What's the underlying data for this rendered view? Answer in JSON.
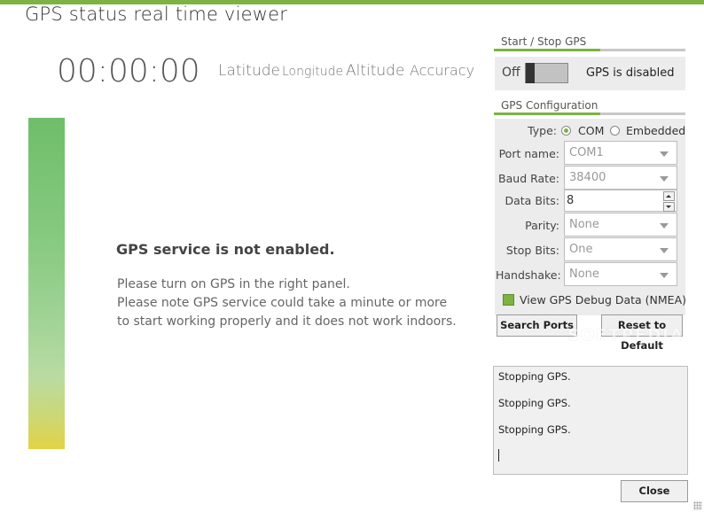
{
  "app": {
    "title": "GPS status real time viewer"
  },
  "readout": {
    "timer": "00:00:00",
    "columns": [
      "Latitude",
      "Longitude",
      "Altitude",
      "Accuracy"
    ]
  },
  "signal_bar": {
    "colors": [
      "#6fbe6b",
      "#9fd394",
      "#e2d345"
    ]
  },
  "message": {
    "title": "GPS service is not enabled.",
    "lines": [
      "Please turn on GPS in the right panel.",
      "Please note GPS service could take a minute or more",
      "to start working properly and it does not work indoors."
    ]
  },
  "start_stop": {
    "header": "Start / Stop GPS",
    "toggle_label": "Off",
    "toggle_on": false,
    "status": "GPS is disabled"
  },
  "config": {
    "header": "GPS Configuration",
    "type_label": "Type:",
    "type_options": [
      "COM",
      "Embedded"
    ],
    "type_selected": "COM",
    "port_label": "Port name:",
    "port_value": "COM1",
    "baud_label": "Baud Rate:",
    "baud_value": "38400",
    "databits_label": "Data Bits:",
    "databits_value": "8",
    "parity_label": "Parity:",
    "parity_value": "None",
    "stopbits_label": "Stop Bits:",
    "stopbits_value": "One",
    "handshake_label": "Handshake:",
    "handshake_value": "None",
    "debug_label": "View GPS Debug Data (NMEA)",
    "debug_checked": true,
    "search_label": "Search Ports",
    "reset_label": "Reset to Default"
  },
  "watermark": "SOFTPEDIA",
  "log": {
    "lines": [
      "Stopping GPS.",
      "Stopping GPS.",
      "Stopping GPS."
    ]
  },
  "close_label": "Close",
  "theme": {
    "accent": "#7cb342"
  }
}
